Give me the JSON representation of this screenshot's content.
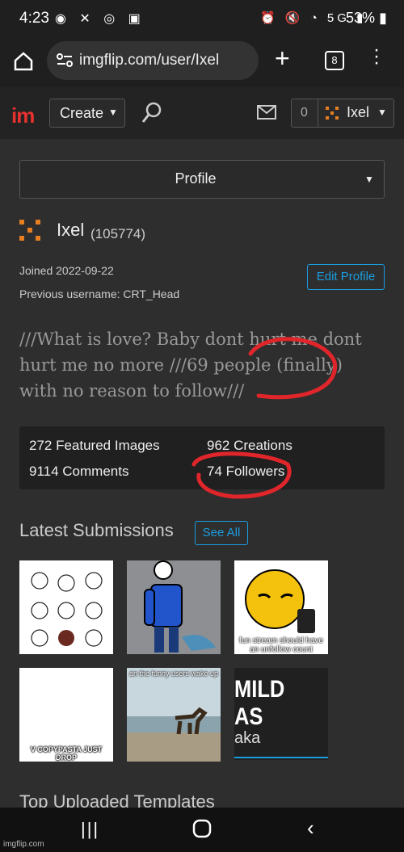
{
  "status": {
    "time": "4:23",
    "battery": "53%",
    "network": "5G"
  },
  "browser": {
    "url": "imgflip.com/user/Ixel",
    "tab_count": "8"
  },
  "header": {
    "create_label": "Create",
    "notif_count": "0",
    "username": "Ixel"
  },
  "profile": {
    "dropdown_label": "Profile",
    "username": "Ixel",
    "points": "(105774)",
    "joined": "Joined 2022-09-22",
    "previous_username": "Previous username: CRT_Head",
    "edit_label": "Edit Profile",
    "bio": "///What is love? Baby dont hurt me dont hurt me no more ///69 people (finally) with no reason to follow///"
  },
  "stats": {
    "featured": "272 Featured Images",
    "creations": "962 Creations",
    "comments": "9114 Comments",
    "followers": "74 Followers"
  },
  "submissions": {
    "title": "Latest Submissions",
    "see_all": "See All",
    "captions": [
      "fun stream should have an unfollow count",
      "an the funny users wake up",
      "MILD AS",
      "aka",
      "V COPYPASTA JUST DROP"
    ]
  },
  "templates_title": "Top Uploaded Templates",
  "watermark": "imgflip.com",
  "colors": {
    "accent": "#e67e22",
    "link": "#1a9de0",
    "annotation": "#e0262b"
  }
}
